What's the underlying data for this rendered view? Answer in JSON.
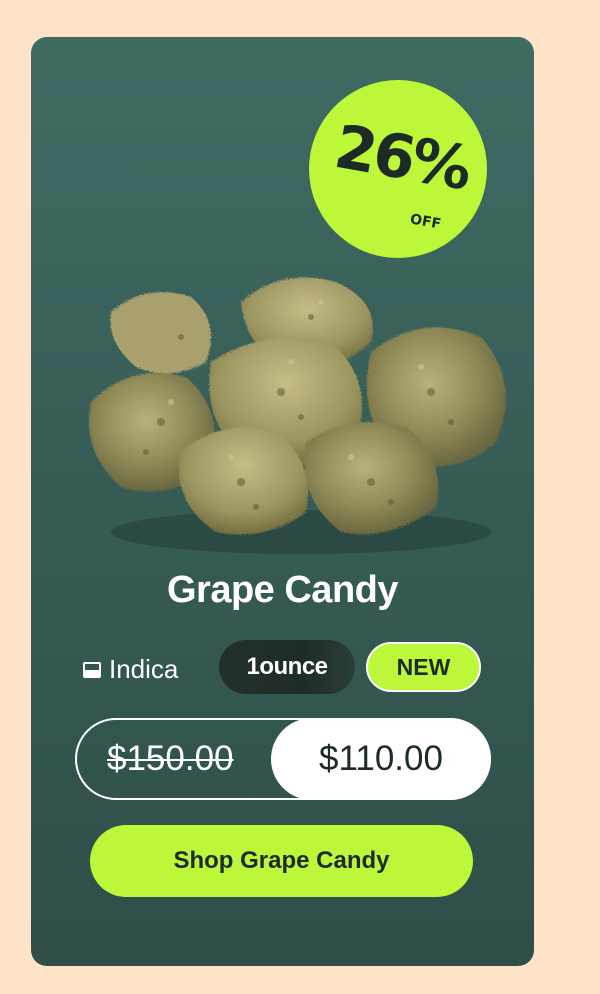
{
  "product": {
    "title": "Grape Candy",
    "strain_type": "Indica",
    "size": "1ounce",
    "new_label": "NEW"
  },
  "discount": {
    "percent": "26%",
    "off_label": "OFF"
  },
  "price": {
    "original": "$150.00",
    "sale": "$110.00"
  },
  "cta": {
    "label": "Shop Grape Candy"
  },
  "icons": {
    "strain": "indica-icon",
    "product": "cannabis-buds-image"
  },
  "colors": {
    "accent": "#bdf73a",
    "card": "#3f6b63",
    "page_bg": "#fde3c8"
  }
}
